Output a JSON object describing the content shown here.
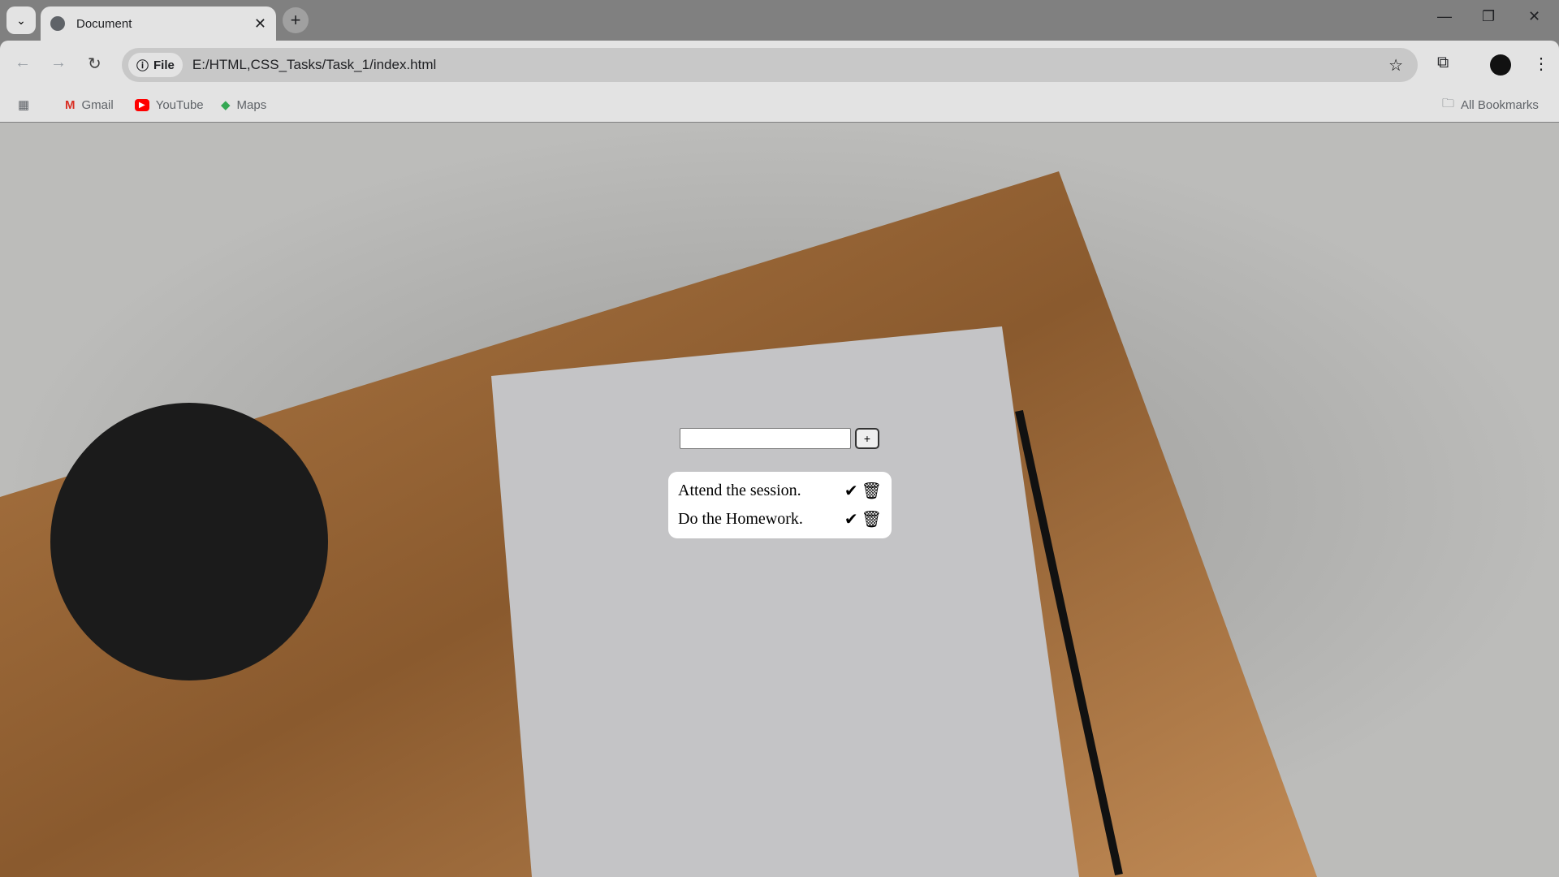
{
  "browser": {
    "tab_title": "Document",
    "url_chip": "File",
    "url": "E:/HTML,CSS_Tasks/Task_1/index.html",
    "bookmarks": [
      {
        "label": "Gmail",
        "icon": "gmail-icon"
      },
      {
        "label": "YouTube",
        "icon": "youtube-icon"
      },
      {
        "label": "Maps",
        "icon": "maps-icon"
      }
    ],
    "all_bookmarks": "All Bookmarks"
  },
  "todo": {
    "input_value": "",
    "add_label": "+",
    "items": [
      {
        "text": "Attend the session."
      },
      {
        "text": "Do the Homework."
      }
    ],
    "done_glyph": "✔",
    "delete_glyph": "🗑"
  }
}
